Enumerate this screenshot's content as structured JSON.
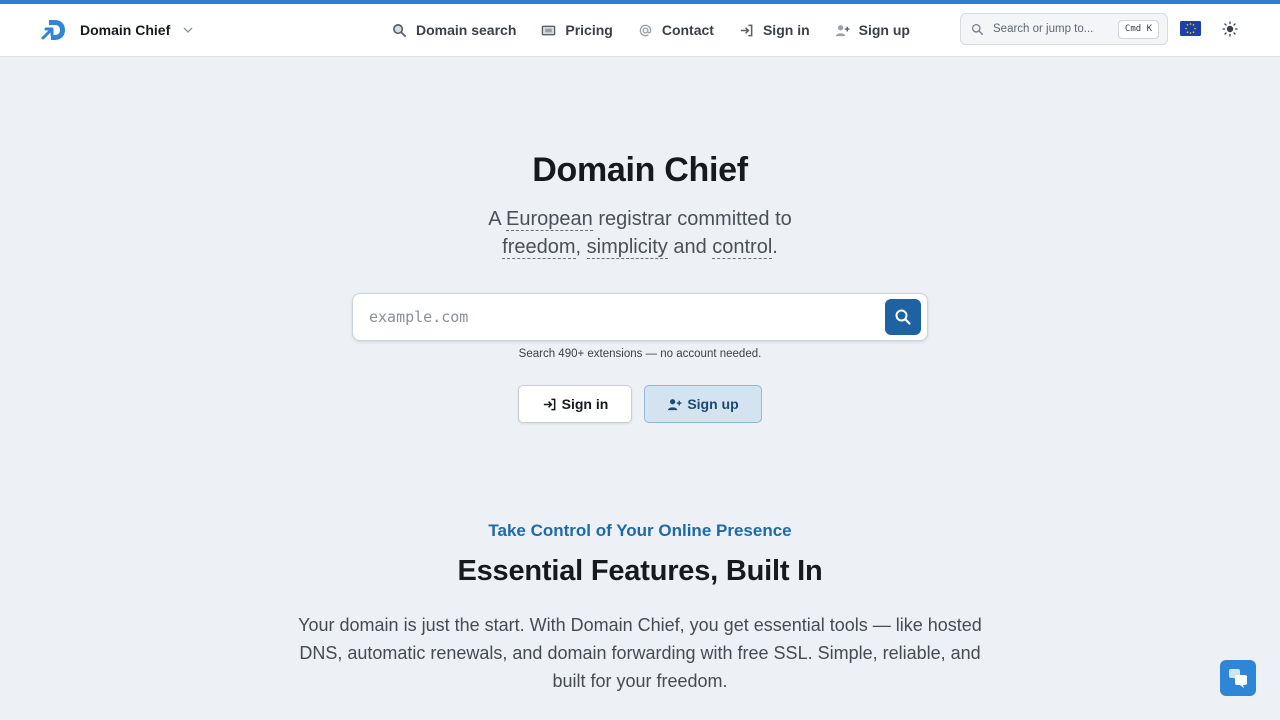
{
  "header": {
    "brand_name": "Domain Chief",
    "nav": [
      {
        "label": "Domain search",
        "icon": "search-icon"
      },
      {
        "label": "Pricing",
        "icon": "ticket-icon"
      },
      {
        "label": "Contact",
        "icon": "at-sign-icon"
      },
      {
        "label": "Sign in",
        "icon": "sign-in-icon"
      },
      {
        "label": "Sign up",
        "icon": "user-plus-icon"
      }
    ],
    "jump_search": {
      "placeholder": "Search or jump to...",
      "shortcut": "Cmd K"
    },
    "language_flag": "eu-flag-icon",
    "theme_icon": "sun-icon"
  },
  "hero": {
    "title": "Domain Chief",
    "subtitle_parts": {
      "a": "A ",
      "european": "European",
      "b": " registrar committed to",
      "freedom": "freedom",
      "comma": ", ",
      "simplicity": "simplicity",
      "and": " and ",
      "control": "control",
      "period": "."
    },
    "search": {
      "placeholder": "example.com",
      "value": ""
    },
    "hint": "Search 490+ extensions — no account needed.",
    "signin_label": "Sign in",
    "signup_label": "Sign up"
  },
  "features": {
    "eyebrow": "Take Control of Your Online Presence",
    "title": "Essential Features, Built In",
    "body": "Your domain is just the start. With Domain Chief, you get essential tools — like hosted DNS, automatic renewals, and domain forwarding with free SSL. Simple, reliable, and built for your freedom."
  },
  "colors": {
    "accent": "#2f7fd1",
    "primary_button": "#1e62a3",
    "eyebrow": "#1e69a8",
    "background": "#edf1f5"
  }
}
